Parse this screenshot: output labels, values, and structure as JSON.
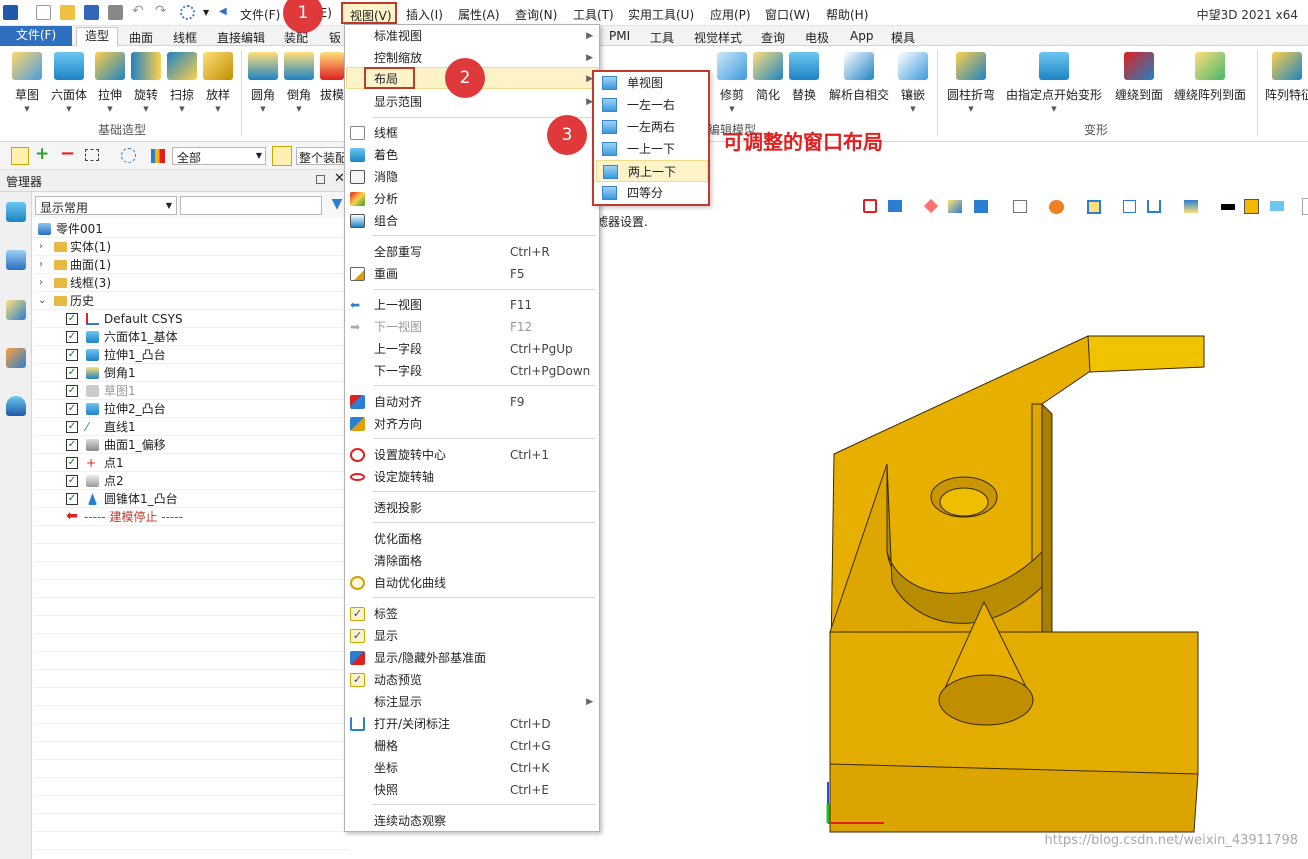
{
  "app": {
    "title": "中望3D 2021 x64"
  },
  "menubar": {
    "items": [
      "文件(F)",
      "(E)",
      "视图(V)",
      "插入(I)",
      "属性(A)",
      "查询(N)",
      "工具(T)",
      "实用工具(U)",
      "应用(P)",
      "窗口(W)",
      "帮助(H)"
    ]
  },
  "tabs": {
    "file": "文件(F)",
    "active": "造型",
    "left": [
      "曲面",
      "线框",
      "直接编辑",
      "装配",
      "钣"
    ],
    "right": [
      "PMI",
      "工具",
      "视觉样式",
      "查询",
      "电极",
      "App",
      "模具"
    ]
  },
  "ribbon": {
    "left_buttons": [
      "草图",
      "六面体",
      "拉伸",
      "旋转",
      "扫掠",
      "放样"
    ],
    "mid_buttons": [
      "圆角",
      "倒角",
      "拔模"
    ],
    "right_buttons": [
      "修剪",
      "简化",
      "替换",
      "解析自相交",
      "镶嵌",
      "圆柱折弯",
      "由指定点开始变形",
      "缠绕到面",
      "缠绕阵列到面",
      "阵列特征"
    ],
    "group_labels": {
      "basic": "基础造型",
      "edit": "编辑模型",
      "deform": "变形"
    }
  },
  "toolbar2": {
    "combo_value": "全部",
    "assembly_label": "整个装配"
  },
  "manager": {
    "title": "管理器",
    "filter_value": "显示常用",
    "tree": [
      {
        "label": "零件001"
      },
      {
        "label": "实体(1)"
      },
      {
        "label": "曲面(1)"
      },
      {
        "label": "线框(3)"
      },
      {
        "label": "历史"
      },
      {
        "label": "Default CSYS"
      },
      {
        "label": "六面体1_基体"
      },
      {
        "label": "拉伸1_凸台"
      },
      {
        "label": "倒角1"
      },
      {
        "label": "草图1"
      },
      {
        "label": "拉伸2_凸台"
      },
      {
        "label": "直线1"
      },
      {
        "label": "曲面1_偏移"
      },
      {
        "label": "点1"
      },
      {
        "label": "点2"
      },
      {
        "label": "圆锥体1_凸台"
      },
      {
        "label": "----- 建模停止 -----"
      }
    ]
  },
  "view_menu": {
    "items": [
      {
        "label": "标准视图",
        "shortcut": ""
      },
      {
        "label": "控制缩放",
        "shortcut": ""
      },
      {
        "label": "布局",
        "shortcut": ""
      },
      {
        "label": "显示范围",
        "shortcut": ""
      },
      {
        "label": "线框",
        "shortcut": ""
      },
      {
        "label": "着色",
        "shortcut": ""
      },
      {
        "label": "消隐",
        "shortcut": ""
      },
      {
        "label": "分析",
        "shortcut": ""
      },
      {
        "label": "组合",
        "shortcut": ""
      },
      {
        "label": "全部重写",
        "shortcut": "Ctrl+R"
      },
      {
        "label": "重画",
        "shortcut": "F5"
      },
      {
        "label": "上一视图",
        "shortcut": "F11"
      },
      {
        "label": "下一视图",
        "shortcut": "F12"
      },
      {
        "label": "上一字段",
        "shortcut": "Ctrl+PgUp"
      },
      {
        "label": "下一字段",
        "shortcut": "Ctrl+PgDown"
      },
      {
        "label": "自动对齐",
        "shortcut": "F9"
      },
      {
        "label": "对齐方向",
        "shortcut": ""
      },
      {
        "label": "设置旋转中心",
        "shortcut": "Ctrl+1"
      },
      {
        "label": "设定旋转轴",
        "shortcut": ""
      },
      {
        "label": "透视投影",
        "shortcut": ""
      },
      {
        "label": "优化面格",
        "shortcut": ""
      },
      {
        "label": "清除面格",
        "shortcut": ""
      },
      {
        "label": "自动优化曲线",
        "shortcut": ""
      },
      {
        "label": "标签",
        "shortcut": ""
      },
      {
        "label": "显示",
        "shortcut": ""
      },
      {
        "label": "显示/隐藏外部基准面",
        "shortcut": ""
      },
      {
        "label": "动态预览",
        "shortcut": ""
      },
      {
        "label": "标注显示",
        "shortcut": ""
      },
      {
        "label": "打开/关闭标注",
        "shortcut": "Ctrl+D"
      },
      {
        "label": "栅格",
        "shortcut": "Ctrl+G"
      },
      {
        "label": "坐标",
        "shortcut": "Ctrl+K"
      },
      {
        "label": "快照",
        "shortcut": "Ctrl+E"
      },
      {
        "label": "连续动态观察",
        "shortcut": ""
      }
    ]
  },
  "layout_submenu": {
    "items": [
      "单视图",
      "一左一右",
      "一左两右",
      "一上一下",
      "两上一下",
      "四等分"
    ]
  },
  "annotations": {
    "step1": "1",
    "step2": "2",
    "step3": "3",
    "note": "可调整的窗口布局"
  },
  "graphics": {
    "filter_hint": "滤器设置."
  },
  "watermark": "https://blog.csdn.net/weixin_43911798",
  "colors": {
    "accent": "#2f6fc0",
    "highlight": "#fdf3c8",
    "annotation": "#e0393c",
    "part": "#dfa500"
  }
}
